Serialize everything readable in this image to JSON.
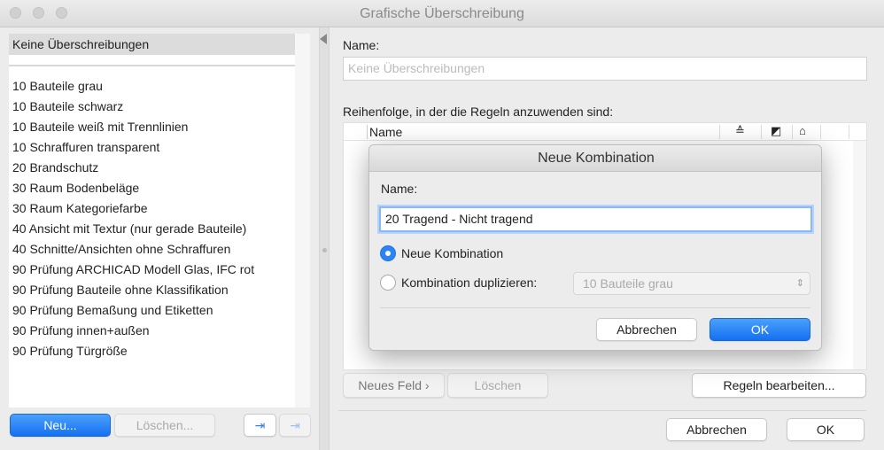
{
  "window": {
    "title": "Grafische Überschreibung"
  },
  "left": {
    "selected_item": "Keine Überschreibungen",
    "items": [
      "10 Bauteile grau",
      "10 Bauteile schwarz",
      "10 Bauteile weiß mit Trennlinien",
      "10 Schraffuren transparent",
      "20 Brandschutz",
      "30 Raum Bodenbeläge",
      "30 Raum Kategoriefarbe",
      "40 Ansicht mit Textur (nur gerade Bauteile)",
      "40 Schnitte/Ansichten ohne Schraffuren",
      "90 Prüfung ARCHICAD Modell Glas, IFC rot",
      "90 Prüfung Bauteile ohne Klassifikation",
      "90 Prüfung Bemaßung und Etiketten",
      "90 Prüfung innen+außen",
      "90 Prüfung Türgröße"
    ],
    "new_label": "Neu...",
    "delete_label": "Löschen..."
  },
  "right": {
    "name_label": "Name:",
    "name_placeholder": "Keine Überschreibungen",
    "order_label": "Reihenfolge, in der die Regeln anzuwenden sind:",
    "table_header": "Name",
    "new_field_label": "Neues Feld",
    "delete_label": "Löschen",
    "edit_rules_label": "Regeln bearbeiten...",
    "cancel_label": "Abbrechen",
    "ok_label": "OK"
  },
  "dialog": {
    "title": "Neue Kombination",
    "name_label": "Name:",
    "name_value": "20 Tragend - Nicht tragend",
    "option_new": "Neue Kombination",
    "option_duplicate": "Kombination duplizieren:",
    "duplicate_source": "10 Bauteile grau",
    "cancel_label": "Abbrechen",
    "ok_label": "OK"
  }
}
